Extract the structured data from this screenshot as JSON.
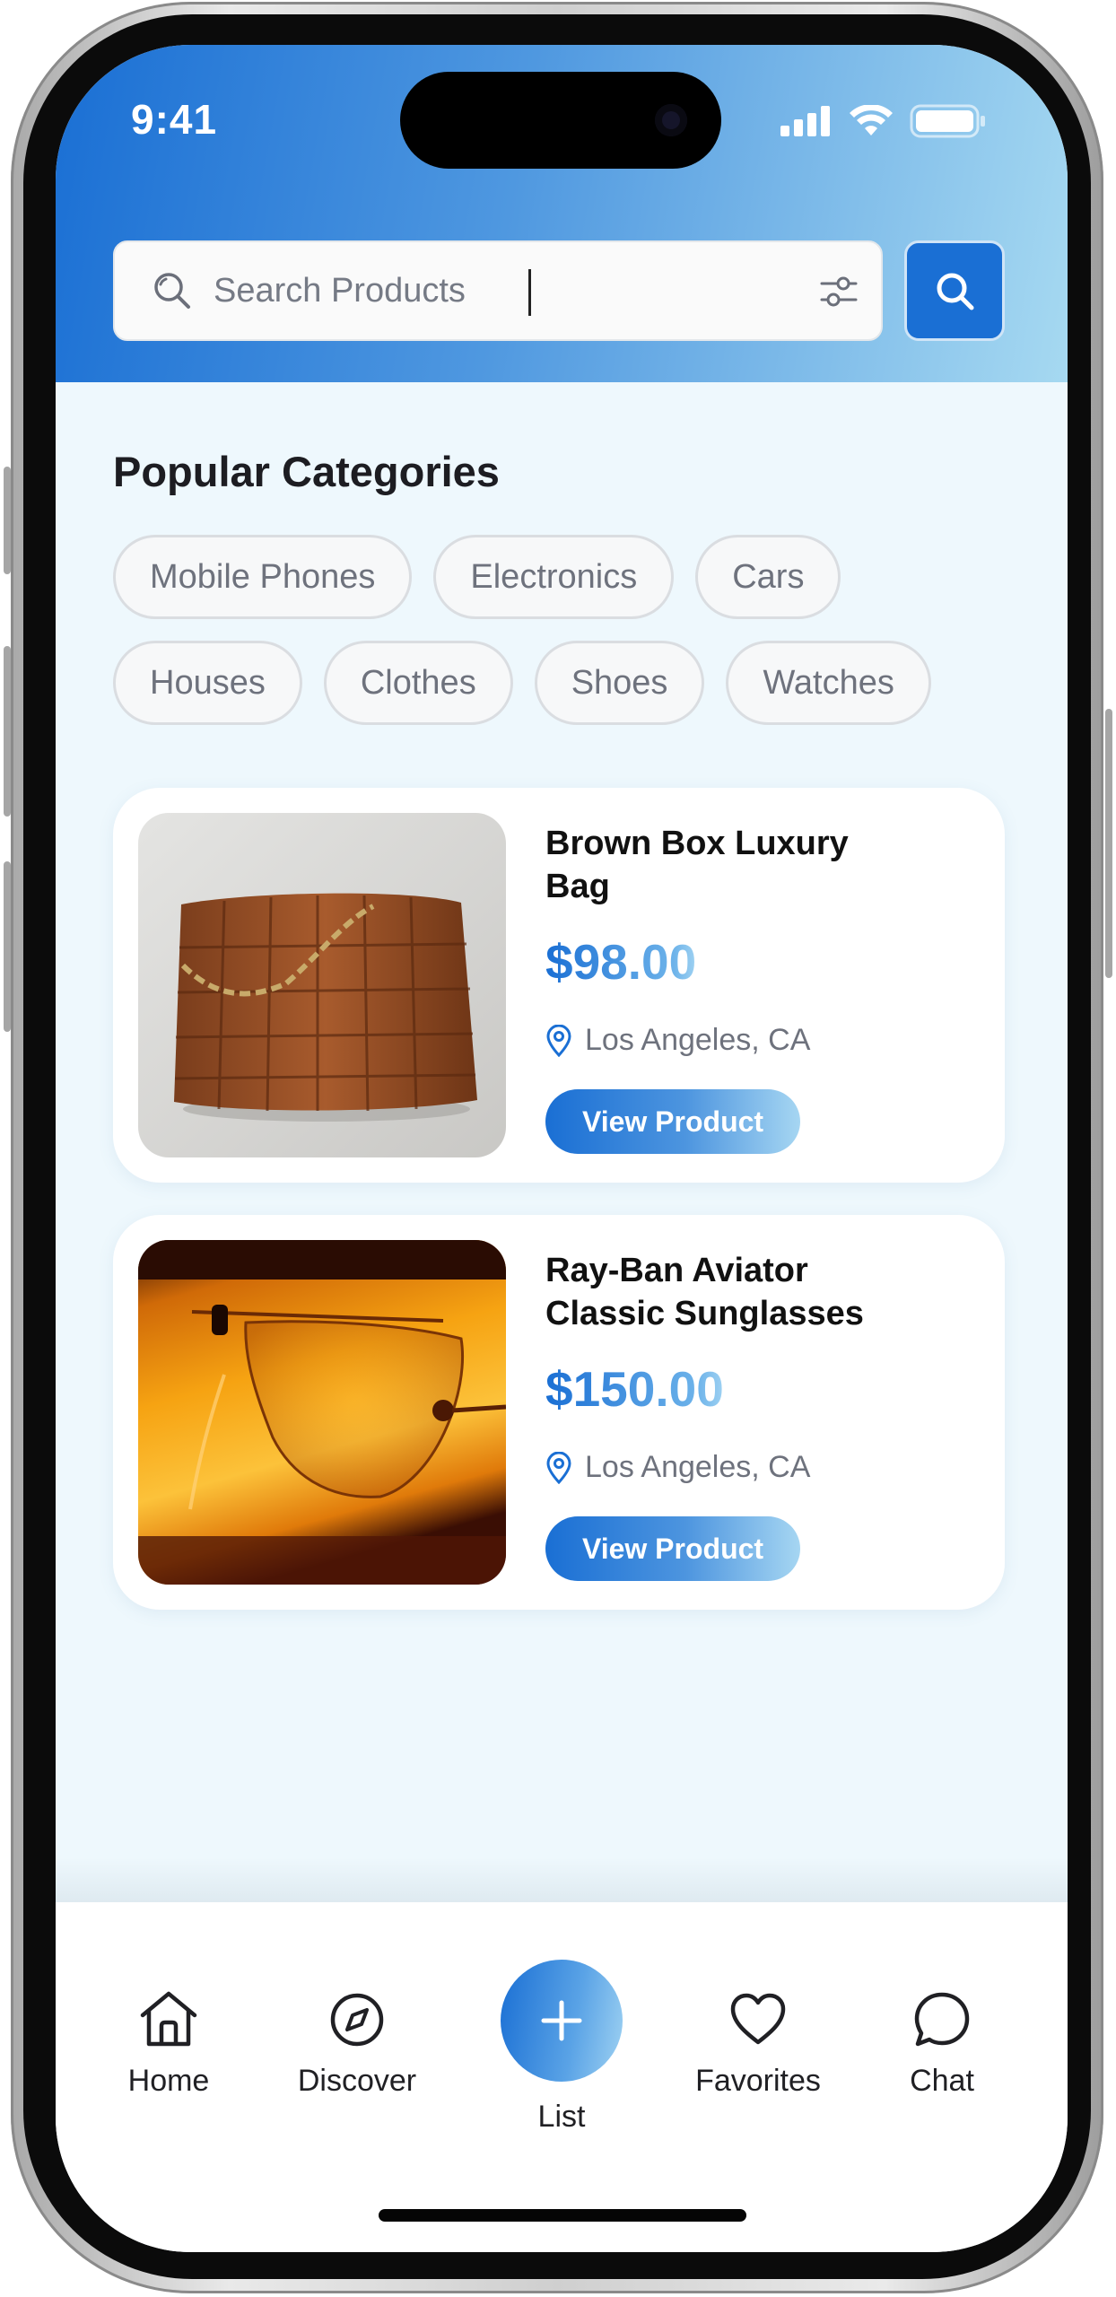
{
  "status_bar": {
    "time": "9:41"
  },
  "search": {
    "placeholder": "Search Products"
  },
  "categories": {
    "title": "Popular Categories",
    "chips": [
      "Mobile Phones",
      "Electronics",
      "Cars",
      "Houses",
      "Clothes",
      "Shoes",
      "Watches"
    ]
  },
  "products": [
    {
      "title": "Brown Box Luxury Bag",
      "price": "$98.00",
      "location": "Los Angeles, CA",
      "button_label": "View Product",
      "image": "brown-woven-leather-bag"
    },
    {
      "title": "Ray-Ban Aviator Classic Sunglasses",
      "price": "$150.00",
      "location": "Los Angeles, CA",
      "button_label": "View Product",
      "image": "aviator-sunglasses"
    }
  ],
  "bottom_nav": {
    "home": "Home",
    "discover": "Discover",
    "list": "List",
    "favorites": "Favorites",
    "chat": "Chat"
  },
  "colors": {
    "accent": "#1a6fd4",
    "accent_light": "#a6d9f1",
    "background": "#eef8fd"
  }
}
